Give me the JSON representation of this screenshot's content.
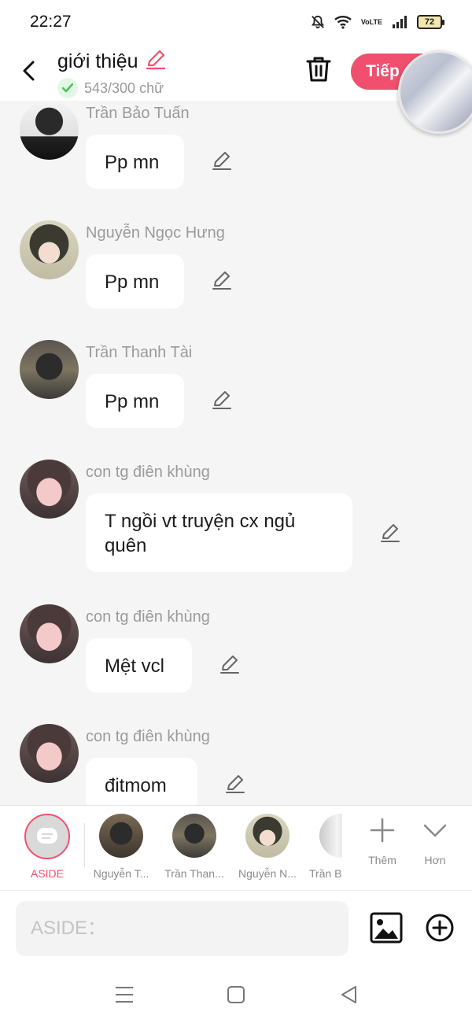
{
  "status": {
    "time": "22:27",
    "volte_top": "Vo",
    "volte_bottom": "LTE",
    "battery": "72"
  },
  "header": {
    "title": "giới thiệu",
    "word_count": "543/300 chữ",
    "next_label": "Tiếp"
  },
  "colors": {
    "accent": "#f0506e",
    "check": "#4cc25b"
  },
  "messages": [
    {
      "name": "Trần Bảo Tuấn",
      "text": "Pp mn"
    },
    {
      "name": "Nguyễn Ngọc Hưng",
      "text": "Pp mn"
    },
    {
      "name": "Trần Thanh Tài",
      "text": "Pp mn"
    },
    {
      "name": "con tg điên khùng",
      "text_line1": "T ngồi vt truyện cx ngủ",
      "text_line2": "quên"
    },
    {
      "name": "con tg điên khùng",
      "text": "Mệt vcl"
    },
    {
      "name": "con tg điên khùng",
      "text": "đitmom"
    }
  ],
  "tray": {
    "aside_label": "ASIDE",
    "characters": [
      "Nguyễn T...",
      "Trần Than...",
      "Nguyễn N...",
      "Trần B"
    ],
    "add_label": "Thêm",
    "more_label": "Hơn"
  },
  "composer": {
    "placeholder": "ASIDE："
  }
}
